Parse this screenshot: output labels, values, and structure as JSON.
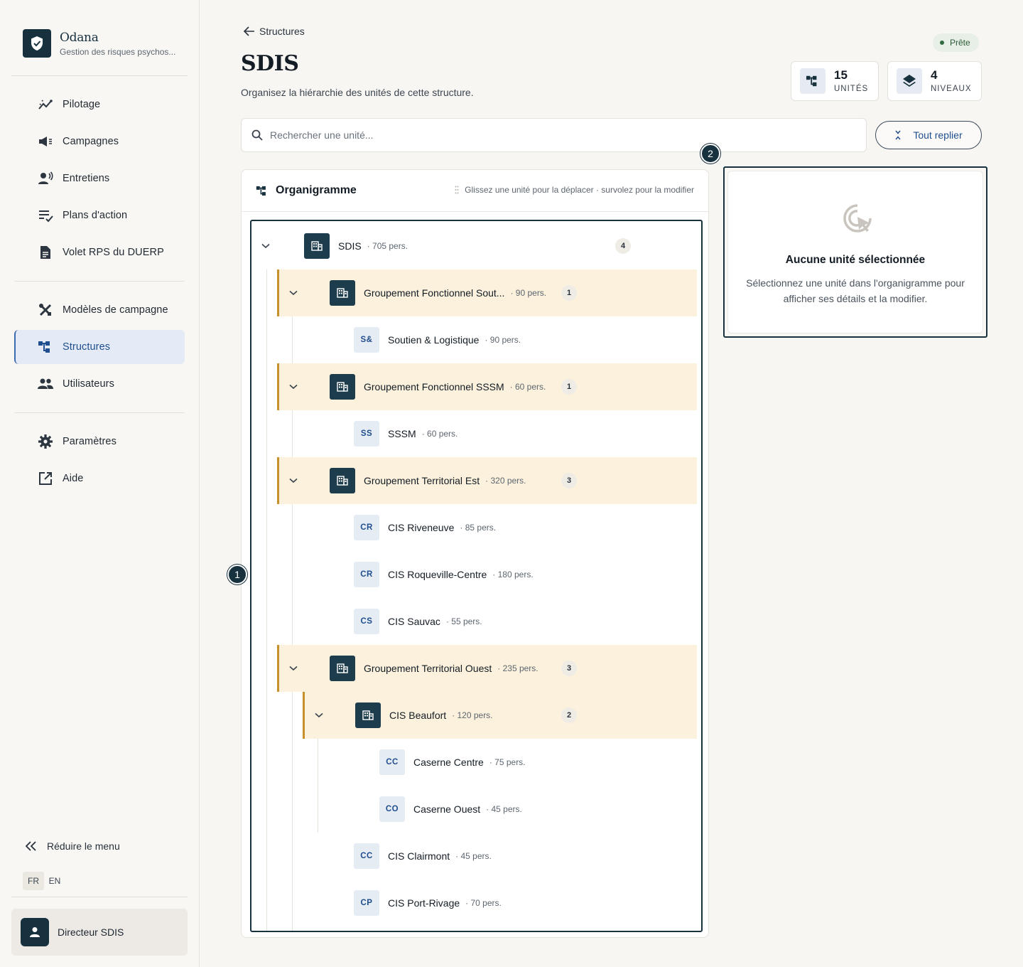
{
  "brand": {
    "name": "Odana",
    "subtitle": "Gestion des risques psychos..."
  },
  "nav": {
    "group1": [
      {
        "label": "Pilotage",
        "icon": "analytics-icon"
      },
      {
        "label": "Campagnes",
        "icon": "megaphone-icon"
      },
      {
        "label": "Entretiens",
        "icon": "voice-person-icon"
      },
      {
        "label": "Plans d'action",
        "icon": "checklist-icon"
      },
      {
        "label": "Volet RPS du DUERP",
        "icon": "document-icon"
      }
    ],
    "group2": [
      {
        "label": "Modèles de campagne",
        "icon": "tools-icon"
      },
      {
        "label": "Structures",
        "icon": "hierarchy-icon",
        "active": true
      },
      {
        "label": "Utilisateurs",
        "icon": "group-icon"
      }
    ],
    "group3": [
      {
        "label": "Paramètres",
        "icon": "gear-icon"
      },
      {
        "label": "Aide",
        "icon": "external-link-icon"
      }
    ]
  },
  "sidebar_footer": {
    "collapse_label": "Réduire le menu",
    "languages": [
      "FR",
      "EN"
    ],
    "active_language": "FR",
    "user_name": "Directeur SDIS"
  },
  "header": {
    "back_label": "Structures",
    "title": "SDIS",
    "subtitle": "Organisez la hiérarchie des unités de cette structure.",
    "status": "Prête"
  },
  "stats": [
    {
      "value": "15",
      "label": "UNITÉS",
      "icon": "hierarchy-icon"
    },
    {
      "value": "4",
      "label": "NIVEAUX",
      "icon": "layers-icon"
    }
  ],
  "search": {
    "placeholder": "Rechercher une unité..."
  },
  "fold_button": "Tout replier",
  "markers": [
    "1",
    "2"
  ],
  "org": {
    "title": "Organigramme",
    "hint": "Glissez une unité pour la déplacer · survolez pour la modifier",
    "units": [
      {
        "name": "SDIS",
        "count": "· 705 pers.",
        "badge": "4",
        "type": "root"
      },
      {
        "name": "Groupement Fonctionnel Sout...",
        "count": "· 90 pers.",
        "badge": "1",
        "type": "group"
      },
      {
        "name": "Soutien & Logistique",
        "count": "· 90 pers.",
        "abbr": "S&",
        "type": "leaf"
      },
      {
        "name": "Groupement Fonctionnel SSSM",
        "count": "· 60 pers.",
        "badge": "1",
        "type": "group"
      },
      {
        "name": "SSSM",
        "count": "· 60 pers.",
        "abbr": "SS",
        "type": "leaf"
      },
      {
        "name": "Groupement Territorial Est",
        "count": "· 320 pers.",
        "badge": "3",
        "type": "group"
      },
      {
        "name": "CIS Riveneuve",
        "count": "· 85 pers.",
        "abbr": "CR",
        "type": "leaf"
      },
      {
        "name": "CIS Roqueville-Centre",
        "count": "· 180 pers.",
        "abbr": "CR",
        "type": "leaf"
      },
      {
        "name": "CIS Sauvac",
        "count": "· 55 pers.",
        "abbr": "CS",
        "type": "leaf"
      },
      {
        "name": "Groupement Territorial Ouest",
        "count": "· 235 pers.",
        "badge": "3",
        "type": "group"
      },
      {
        "name": "CIS Beaufort",
        "count": "· 120 pers.",
        "badge": "2",
        "type": "subgroup"
      },
      {
        "name": "Caserne Centre",
        "count": "· 75 pers.",
        "abbr": "CC",
        "type": "leaf2"
      },
      {
        "name": "Caserne Ouest",
        "count": "· 45 pers.",
        "abbr": "CO",
        "type": "leaf2"
      },
      {
        "name": "CIS Clairmont",
        "count": "· 45 pers.",
        "abbr": "CC",
        "type": "leaf"
      },
      {
        "name": "CIS Port-Rivage",
        "count": "· 70 pers.",
        "abbr": "CP",
        "type": "leaf"
      }
    ]
  },
  "detail": {
    "title": "Aucune unité sélectionnée",
    "text": "Sélectionnez une unité dans l'organigramme pour afficher ses détails et la modifier."
  }
}
